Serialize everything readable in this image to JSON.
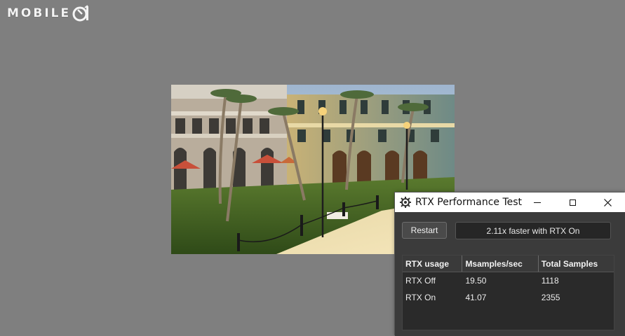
{
  "watermark": {
    "text": "MOBILE"
  },
  "dialog": {
    "title": "RTX Performance Test",
    "restart_label": "Restart",
    "result_text": "2.11x faster with RTX On",
    "table": {
      "headers": [
        "RTX usage",
        "Msamples/sec",
        "Total Samples"
      ],
      "rows": [
        [
          "RTX Off",
          "19.50",
          "1118"
        ],
        [
          "RTX On",
          "41.07",
          "2355"
        ]
      ]
    }
  }
}
